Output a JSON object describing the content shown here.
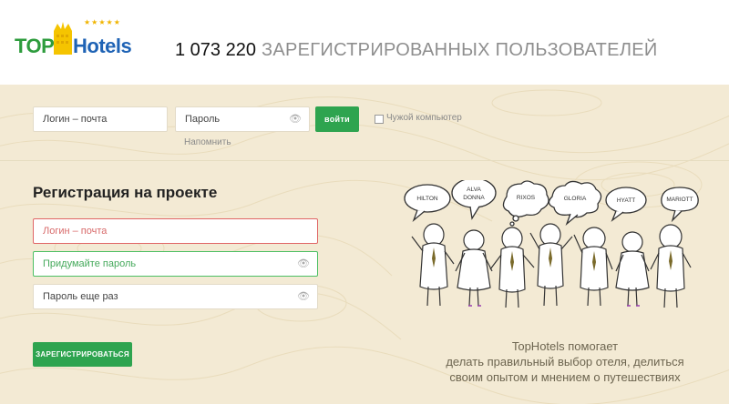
{
  "logo": {
    "top": "TOP",
    "hotels": "Hotels",
    "stars": "★★★★★"
  },
  "header": {
    "users_count": "1 073 220",
    "users_label": "ЗАРЕГИСТРИРОВАННЫХ ПОЛЬЗОВАТЕЛЕЙ"
  },
  "login": {
    "login_placeholder": "Логин – почта",
    "password_placeholder": "Пароль",
    "submit_label": "войти",
    "foreign_computer_label": "Чужой компьютер",
    "remind_label": "Напомнить"
  },
  "registration": {
    "title": "Регистрация на проекте",
    "login_placeholder": "Логин – почта",
    "password_placeholder": "Придумайте пароль",
    "password_repeat_placeholder": "Пароль еще раз",
    "submit_label": "ЗАРЕГИСТРИРОВАТЬСЯ"
  },
  "illustration": {
    "bubbles": [
      "HILTON",
      "ALVA",
      "DONNA",
      "RIXOS",
      "GLORIA",
      "HYATT",
      "MARIOTT"
    ]
  },
  "promo": {
    "line1": "TopHotels помогает",
    "line2": "делать правильный выбор отеля, делиться",
    "line3": "своим опытом и мнением о путешествиях"
  },
  "colors": {
    "accent_green": "#2ea44f",
    "brand_blue": "#1f63b5",
    "background": "#f3ead4",
    "error_red": "#e06666"
  }
}
